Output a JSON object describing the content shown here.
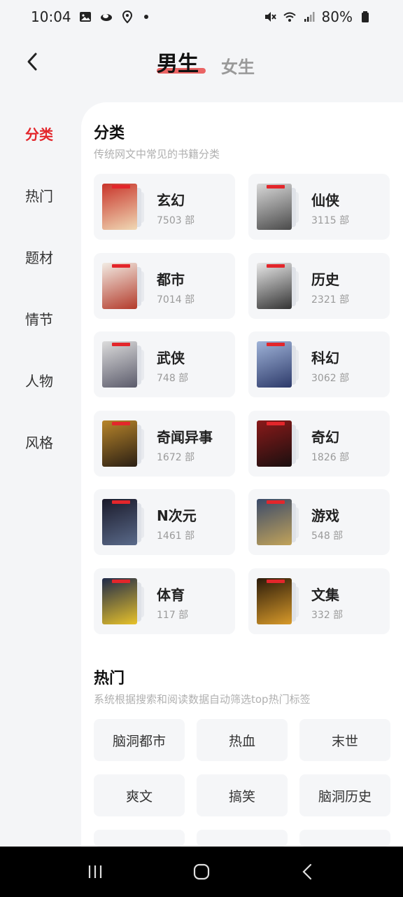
{
  "status_bar": {
    "time": "10:04",
    "battery": "80%",
    "icons": [
      "image-icon",
      "cloud-icon",
      "location-icon",
      "mute-icon",
      "wifi-icon",
      "signal-icon",
      "battery-icon"
    ]
  },
  "header": {
    "tabs": [
      {
        "label": "男生",
        "active": true
      },
      {
        "label": "女生",
        "active": false
      }
    ],
    "accent_color": "#e84a4a"
  },
  "sidebar": {
    "items": [
      {
        "label": "分类",
        "active": true
      },
      {
        "label": "热门",
        "active": false
      },
      {
        "label": "题材",
        "active": false
      },
      {
        "label": "情节",
        "active": false
      },
      {
        "label": "人物",
        "active": false
      },
      {
        "label": "风格",
        "active": false
      }
    ],
    "active_color": "#e3262b"
  },
  "categories": {
    "title": "分类",
    "subtitle": "传统网文中常见的书籍分类",
    "items": [
      {
        "name": "玄幻",
        "count": "7503 部",
        "cover_colors": [
          "#c8342a",
          "#f0d9b5"
        ]
      },
      {
        "name": "仙侠",
        "count": "3115 部",
        "cover_colors": [
          "#d9d9d9",
          "#4a4a4a"
        ]
      },
      {
        "name": "都市",
        "count": "7014 部",
        "cover_colors": [
          "#f2ece4",
          "#b33a2a"
        ]
      },
      {
        "name": "历史",
        "count": "2321 部",
        "cover_colors": [
          "#e9e9e9",
          "#333333"
        ]
      },
      {
        "name": "武侠",
        "count": "748 部",
        "cover_colors": [
          "#dcdcdc",
          "#5b5b6b"
        ]
      },
      {
        "name": "科幻",
        "count": "3062 部",
        "cover_colors": [
          "#9fb3d8",
          "#2d3a6a"
        ]
      },
      {
        "name": "奇闻异事",
        "count": "1672 部",
        "cover_colors": [
          "#b8852a",
          "#2a1f14"
        ]
      },
      {
        "name": "奇幻",
        "count": "1826 部",
        "cover_colors": [
          "#8a1a1a",
          "#1a0f0f"
        ]
      },
      {
        "name": "N次元",
        "count": "1461 部",
        "cover_colors": [
          "#1a1a2a",
          "#5a6a8a"
        ]
      },
      {
        "name": "游戏",
        "count": "548 部",
        "cover_colors": [
          "#3a4a6a",
          "#c2a35a"
        ]
      },
      {
        "name": "体育",
        "count": "117 部",
        "cover_colors": [
          "#1f2a4a",
          "#e8c22a"
        ]
      },
      {
        "name": "文集",
        "count": "332 部",
        "cover_colors": [
          "#2a1a0a",
          "#d89a2a"
        ]
      }
    ]
  },
  "hot": {
    "title": "热门",
    "subtitle": "系统根据搜索和阅读数据自动筛选top热门标签",
    "tags": [
      "脑洞都市",
      "热血",
      "末世",
      "爽文",
      "搞笑",
      "脑洞历史"
    ]
  },
  "nav_bar": {
    "buttons": [
      "recent-apps-icon",
      "home-icon",
      "back-icon"
    ]
  }
}
